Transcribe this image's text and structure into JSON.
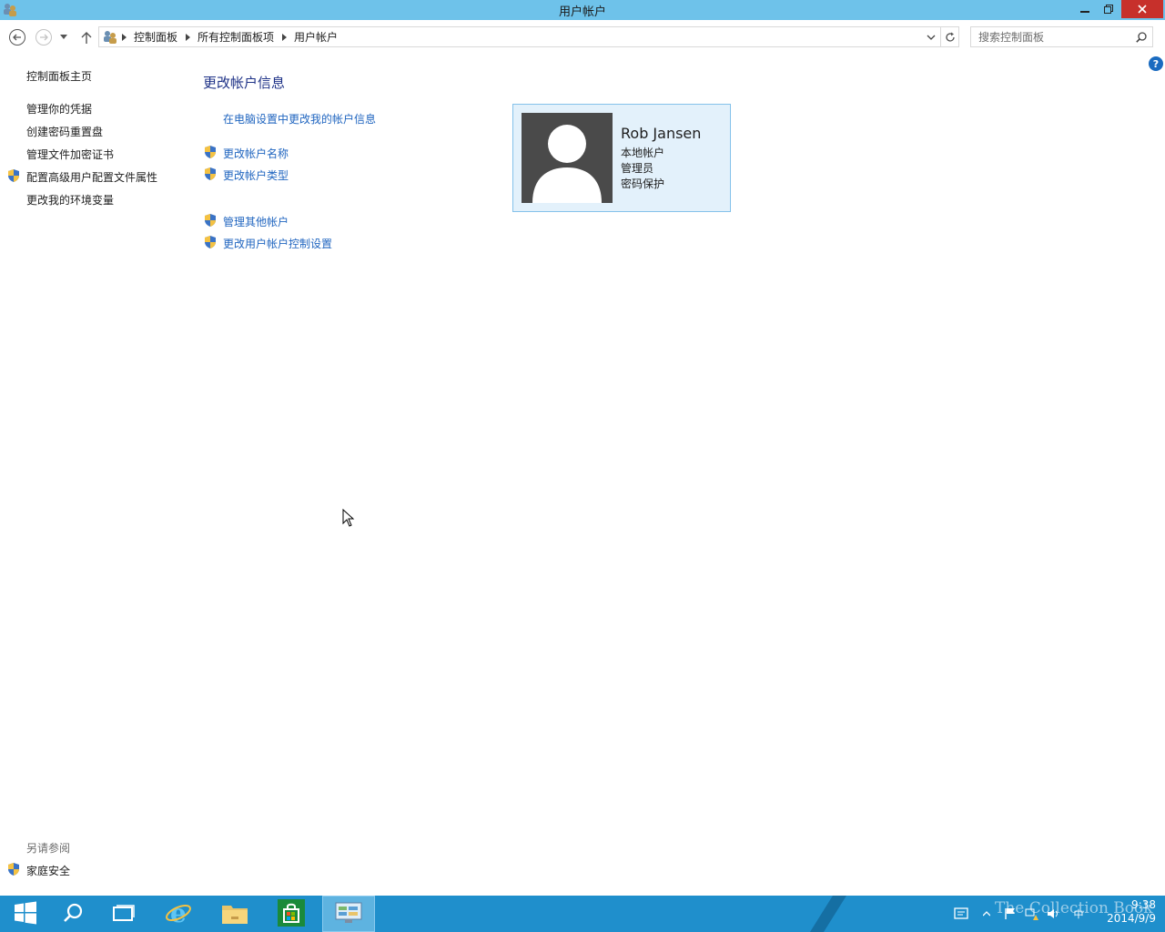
{
  "window": {
    "title": "用户帐户"
  },
  "address": {
    "crumbs": [
      "控制面板",
      "所有控制面板项",
      "用户帐户"
    ],
    "search_placeholder": "搜索控制面板"
  },
  "sidebar": {
    "home": "控制面板主页",
    "items": [
      {
        "label": "管理你的凭据",
        "shield": false
      },
      {
        "label": "创建密码重置盘",
        "shield": false
      },
      {
        "label": "管理文件加密证书",
        "shield": false
      },
      {
        "label": "配置高级用户配置文件属性",
        "shield": true
      },
      {
        "label": "更改我的环境变量",
        "shield": false
      }
    ],
    "see_also_title": "另请参阅",
    "see_also": [
      {
        "label": "家庭安全",
        "shield": true
      }
    ]
  },
  "main": {
    "heading": "更改帐户信息",
    "tasks": [
      {
        "label": "在电脑设置中更改我的帐户信息",
        "shield": false
      },
      {
        "label": "更改帐户名称",
        "shield": true
      },
      {
        "label": "更改帐户类型",
        "shield": true
      },
      {
        "label": "管理其他帐户",
        "shield": true
      },
      {
        "label": "更改用户帐户控制设置",
        "shield": true
      }
    ]
  },
  "account": {
    "name": "Rob Jansen",
    "type": "本地帐户",
    "role": "管理员",
    "protection": "密码保护"
  },
  "taskbar": {
    "items": [
      "start-icon",
      "search-icon",
      "task-view-icon",
      "internet-explorer-icon",
      "file-explorer-icon",
      "store-icon",
      "control-panel-icon"
    ],
    "ime": "中",
    "time": "9:38",
    "date": "2014/9/9",
    "watermark": "The Collection Book"
  },
  "colors": {
    "titlebar": "#6ec2ea",
    "taskbar": "#1f8fcc",
    "link": "#2166c0",
    "close": "#c7302b"
  }
}
